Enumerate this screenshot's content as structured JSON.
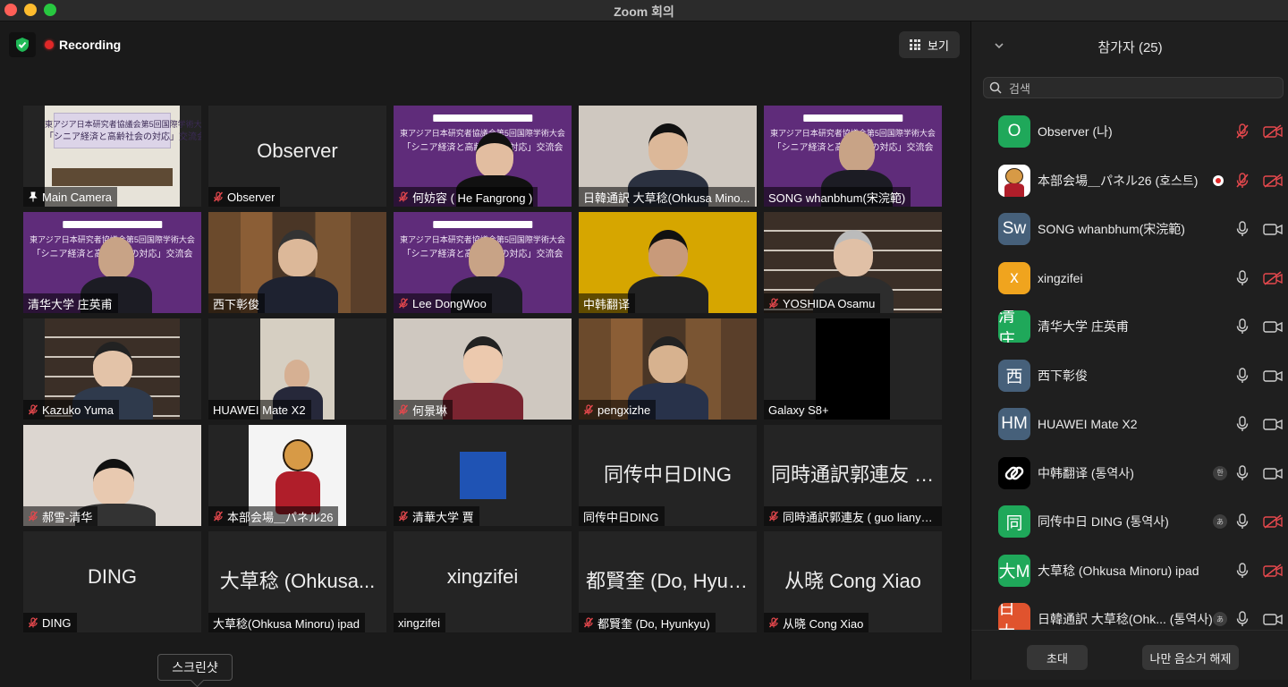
{
  "window": {
    "title": "Zoom 회의"
  },
  "meeting": {
    "recording_label": "Recording",
    "view_label": "보기",
    "tooltip": "스크린샷"
  },
  "tiles": [
    {
      "label": "Main Camera",
      "pinned": true,
      "muted": false,
      "big_name": ""
    },
    {
      "label": "Observer",
      "muted": true,
      "big_name": "Observer"
    },
    {
      "label": "何妨容 ( He Fangrong )",
      "muted": true,
      "big_name": ""
    },
    {
      "label": "日韓通訳 大草稔(Ohkusa Mino...",
      "muted": false,
      "big_name": ""
    },
    {
      "label": "SONG whanbhum(宋浣範)",
      "muted": false,
      "big_name": ""
    },
    {
      "label": "清华大学 庄英甫",
      "muted": false,
      "active": true,
      "big_name": ""
    },
    {
      "label": "西下彰俊",
      "muted": false,
      "big_name": ""
    },
    {
      "label": "Lee DongWoo",
      "muted": true,
      "big_name": ""
    },
    {
      "label": "中韩翻译",
      "muted": false,
      "big_name": ""
    },
    {
      "label": "YOSHIDA Osamu",
      "muted": true,
      "big_name": ""
    },
    {
      "label": "Kazuko Yuma",
      "muted": true,
      "big_name": ""
    },
    {
      "label": "HUAWEI Mate X2",
      "muted": false,
      "big_name": ""
    },
    {
      "label": "何景琳",
      "muted": true,
      "big_name": ""
    },
    {
      "label": "pengxizhe",
      "muted": true,
      "big_name": ""
    },
    {
      "label": "Galaxy S8+",
      "muted": false,
      "big_name": ""
    },
    {
      "label": "郝雪-清华",
      "muted": true,
      "big_name": ""
    },
    {
      "label": "本部会場＿パネル26",
      "muted": true,
      "big_name": ""
    },
    {
      "label": "清華大学 賈",
      "muted": true,
      "big_name": ""
    },
    {
      "label": "同传中日DING",
      "muted": false,
      "big_name": "同传中日DING"
    },
    {
      "label": "同時通訳郭連友 ( guo lianyo...",
      "muted": true,
      "big_name": "同時通訳郭連友 ( ..."
    },
    {
      "label": "DING",
      "muted": true,
      "big_name": "DING"
    },
    {
      "label": "大草稔(Ohkusa Minoru) ipad",
      "muted": false,
      "big_name": "大草稔 (Ohkusa..."
    },
    {
      "label": "xingzifei",
      "muted": false,
      "big_name": "xingzifei"
    },
    {
      "label": "都賢奎 (Do, Hyunkyu)",
      "muted": true,
      "big_name": "都賢奎 (Do, Hyun..."
    },
    {
      "label": "从晓 Cong Xiao",
      "muted": true,
      "big_name": "从晓 Cong Xiao"
    }
  ],
  "slide": {
    "line1": "東アジア日本研究者協議会第5回国際学術大会",
    "line2": "「シニア経済と高齢社会の対応」交流会"
  },
  "panel": {
    "title": "참가자 (25)",
    "search_placeholder": "검색",
    "invite_label": "초대",
    "unmute_label": "나만 음소거 해제",
    "participants": [
      {
        "avatar_text": "O",
        "avatar_color": "#1fa85a",
        "name": "Observer (나)",
        "mic_muted": true,
        "cam_off": true,
        "recording": false,
        "badge": ""
      },
      {
        "avatar_text": "",
        "avatar_color": "#ffffff",
        "avatar_image": "tiger",
        "name": "本部会場＿パネル26 (호스트)",
        "mic_muted": true,
        "cam_off": true,
        "recording": true,
        "badge": ""
      },
      {
        "avatar_text": "Sw",
        "avatar_color": "#46607a",
        "name": "SONG whanbhum(宋浣範)",
        "mic_muted": false,
        "cam_off": false,
        "recording": false,
        "badge": ""
      },
      {
        "avatar_text": "x",
        "avatar_color": "#f0a41e",
        "name": "xingzifei",
        "mic_muted": false,
        "cam_off": true,
        "recording": false,
        "badge": ""
      },
      {
        "avatar_text": "清庄",
        "avatar_color": "#1fa85a",
        "name": "清华大学 庄英甫",
        "mic_muted": false,
        "cam_off": false,
        "recording": false,
        "badge": ""
      },
      {
        "avatar_text": "西",
        "avatar_color": "#46607a",
        "name": "西下彰俊",
        "mic_muted": false,
        "cam_off": false,
        "recording": false,
        "badge": ""
      },
      {
        "avatar_text": "HM",
        "avatar_color": "#46607a",
        "name": "HUAWEI Mate X2",
        "mic_muted": false,
        "cam_off": false,
        "recording": false,
        "badge": ""
      },
      {
        "avatar_text": "",
        "avatar_color": "#000000",
        "avatar_image": "link",
        "name": "中韩翻译 (통역사)",
        "mic_muted": false,
        "cam_off": false,
        "recording": false,
        "badge": "한"
      },
      {
        "avatar_text": "同",
        "avatar_color": "#1fa85a",
        "name": "同传中日 DING (통역사)",
        "mic_muted": false,
        "cam_off": true,
        "recording": false,
        "badge": "あ"
      },
      {
        "avatar_text": "大M",
        "avatar_color": "#1fa85a",
        "name": "大草稔 (Ohkusa Minoru) ipad",
        "mic_muted": false,
        "cam_off": true,
        "recording": false,
        "badge": ""
      },
      {
        "avatar_text": "日大",
        "avatar_color": "#e0532e",
        "name": "日韓通訳 大草稔(Ohk... (통역사)",
        "mic_muted": false,
        "cam_off": false,
        "recording": false,
        "badge": "あ"
      }
    ]
  },
  "colors": {
    "mute_red": "#e5484d",
    "active_border": "#b5b84d",
    "record_red": "#e02828"
  }
}
